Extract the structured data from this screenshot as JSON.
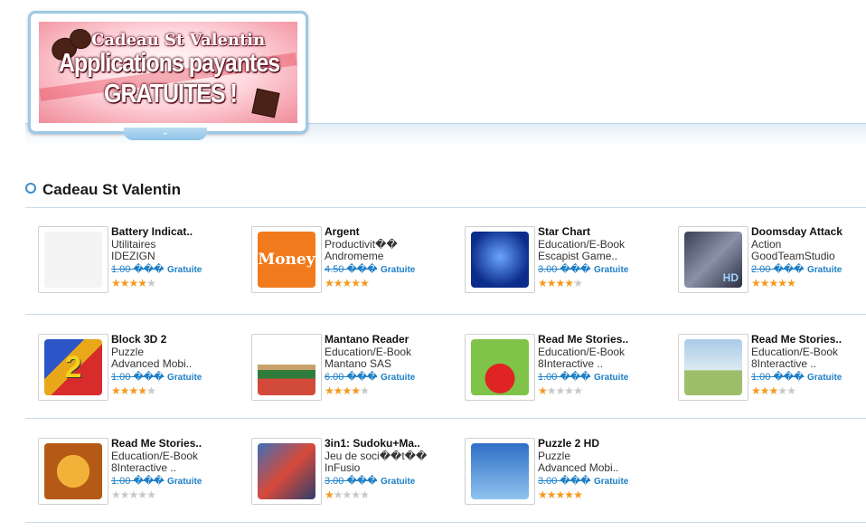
{
  "banner": {
    "line1": "Cadeau St Valentin",
    "line2": "Applications payantes",
    "line3": "GRATUITES !"
  },
  "section": {
    "title": "Cadeau St Valentin"
  },
  "colors": {
    "accent": "#1e7fc6",
    "star_on": "#f39a1e",
    "star_off": "#c8c8c8"
  },
  "apps": [
    {
      "name": "Battery Indicat..",
      "category": "Utilitaires",
      "developer": "IDEZIGN",
      "old_price": "1.00 ���",
      "price": "Gratuite",
      "rating": 3.5,
      "icon": "battery-icon"
    },
    {
      "name": "Argent",
      "category": "Productivit��",
      "developer": "Andromeme",
      "old_price": "4.50 ���",
      "price": "Gratuite",
      "rating": 5,
      "icon": "money-icon",
      "icon_text": "Money"
    },
    {
      "name": "Star Chart",
      "category": "Education/E-Book",
      "developer": "Escapist Game..",
      "old_price": "3.00 ���",
      "price": "Gratuite",
      "rating": 4,
      "icon": "star-chart-icon"
    },
    {
      "name": "Doomsday Attack",
      "category": "Action",
      "developer": "GoodTeamStudio",
      "old_price": "2.00 ���",
      "price": "Gratuite",
      "rating": 4.5,
      "icon": "jet-fighter-icon",
      "icon_text": "HD"
    },
    {
      "name": "Block 3D 2",
      "category": "Puzzle",
      "developer": "Advanced Mobi..",
      "old_price": "1.00 ���",
      "price": "Gratuite",
      "rating": 3.5,
      "icon": "block-3d-icon",
      "icon_text": "2"
    },
    {
      "name": "Mantano Reader",
      "category": "Education/E-Book",
      "developer": "Mantano SAS",
      "old_price": "6.00 ���",
      "price": "Gratuite",
      "rating": 4,
      "icon": "books-icon"
    },
    {
      "name": "Read Me Stories..",
      "category": "Education/E-Book",
      "developer": "8Interactive ..",
      "old_price": "1.00 ���",
      "price": "Gratuite",
      "rating": 1,
      "icon": "pepper-character-icon"
    },
    {
      "name": "Read Me Stories..",
      "category": "Education/E-Book",
      "developer": "8Interactive ..",
      "old_price": "1.00 ���",
      "price": "Gratuite",
      "rating": 3,
      "icon": "knight-character-icon"
    },
    {
      "name": "Read Me Stories..",
      "category": "Education/E-Book",
      "developer": "8Interactive ..",
      "old_price": "1.00 ���",
      "price": "Gratuite",
      "rating": 0,
      "icon": "lion-character-icon"
    },
    {
      "name": "3in1: Sudoku+Ma..",
      "category": "Jeu de soci��t��",
      "developer": "InFusio",
      "old_price": "3.00 ���",
      "price": "Gratuite",
      "rating": 1,
      "icon": "board-game-icon"
    },
    {
      "name": "Puzzle 2 HD",
      "category": "Puzzle",
      "developer": "Advanced Mobi..",
      "old_price": "3.00 ���",
      "price": "Gratuite",
      "rating": 5,
      "icon": "puzzle-blocks-icon"
    }
  ]
}
